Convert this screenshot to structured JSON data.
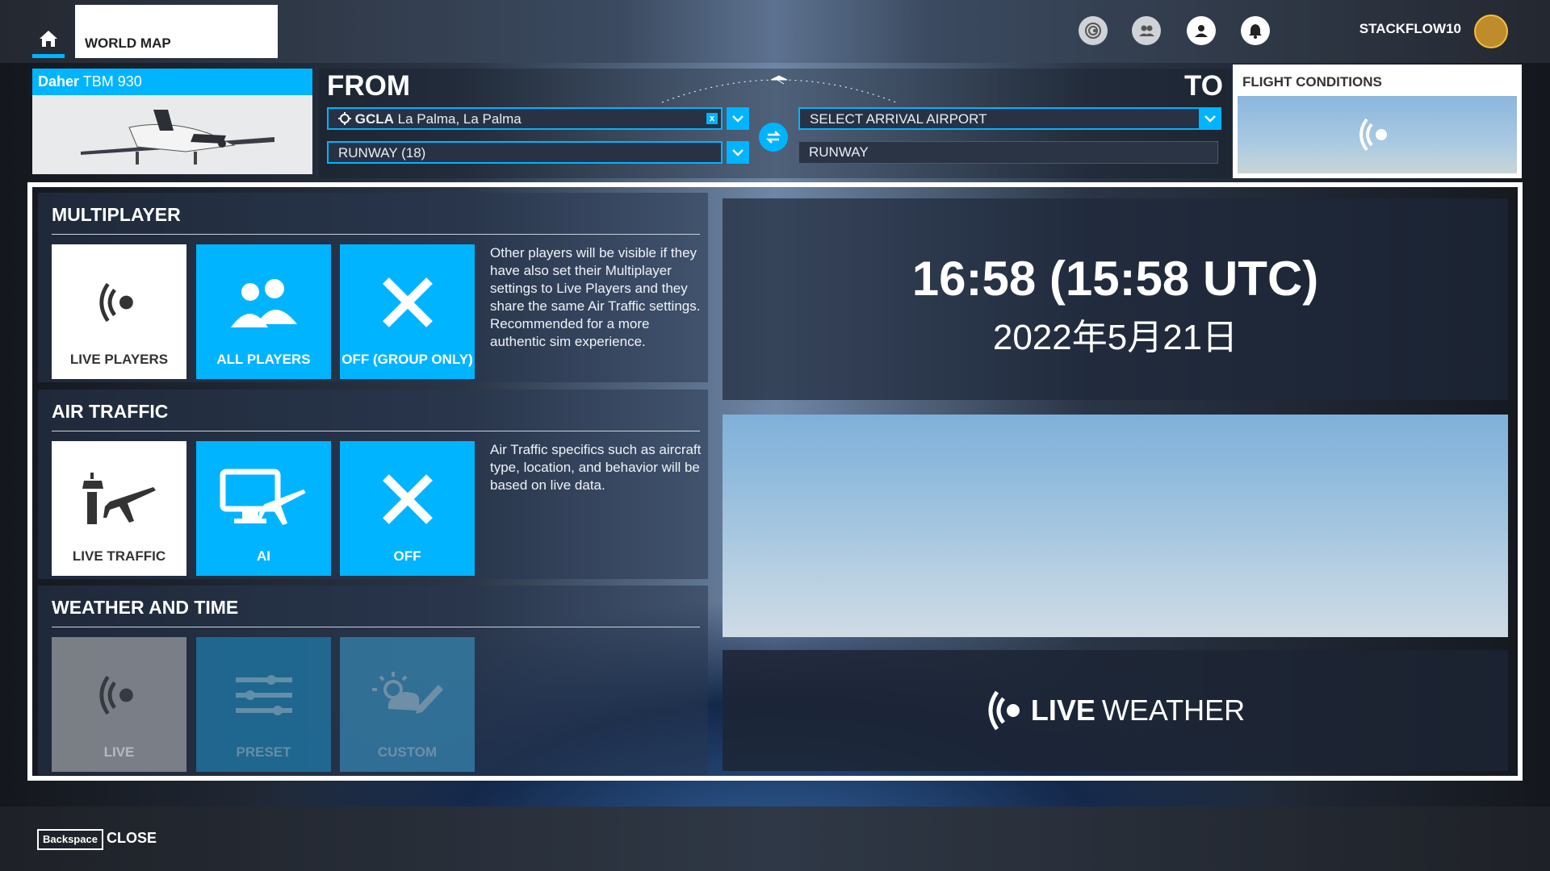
{
  "topbar": {
    "home_icon": "home-icon",
    "world_map_tab": "WORLD MAP",
    "icons": [
      "achievements-icon",
      "friends-icon",
      "profile-icon",
      "notifications-icon"
    ],
    "username": "STACKFLOW10"
  },
  "aircraft": {
    "make": "Daher",
    "model": "TBM 930"
  },
  "route": {
    "from_label": "FROM",
    "to_label": "TO",
    "departure_code": "GCLA",
    "departure_name": "La Palma, La Palma",
    "departure_runway": "RUNWAY (18)",
    "arrival_placeholder": "SELECT ARRIVAL AIRPORT",
    "arrival_runway": "RUNWAY",
    "clear_label": "x"
  },
  "conditions": {
    "title": "FLIGHT CONDITIONS"
  },
  "multiplayer": {
    "title": "MULTIPLAYER",
    "options": [
      "LIVE PLAYERS",
      "ALL PLAYERS",
      "OFF (GROUP ONLY)"
    ],
    "description": "Other players will be visible if they have also set their Multiplayer settings to Live Players and they share the same Air Traffic settings. Recommended for a more authentic sim experience."
  },
  "air_traffic": {
    "title": "AIR TRAFFIC",
    "options": [
      "LIVE TRAFFIC",
      "AI",
      "OFF"
    ],
    "description": "Air Traffic specifics such as aircraft type, location, and behavior will be based on live data."
  },
  "weather_time": {
    "title": "WEATHER AND TIME",
    "options": [
      "LIVE",
      "PRESET",
      "CUSTOM"
    ]
  },
  "clock": {
    "time": "16:58 (15:58 UTC)",
    "date": "2022年5月21日"
  },
  "live_weather": {
    "bold": "LIVE",
    "rest": "WEATHER"
  },
  "footer": {
    "key": "Backspace",
    "close": "CLOSE"
  },
  "colors": {
    "accent": "#00b4ff"
  }
}
